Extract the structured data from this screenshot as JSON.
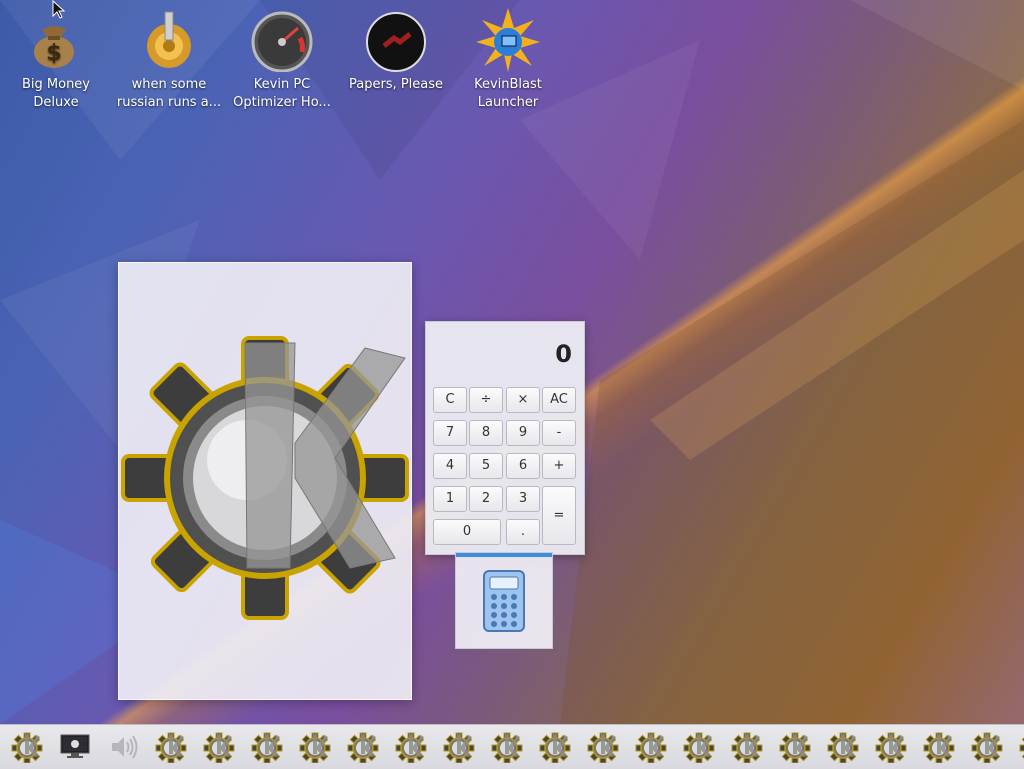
{
  "desktop": {
    "icons": [
      {
        "name": "money-bag-icon",
        "label": "Big Money Deluxe"
      },
      {
        "name": "gear-icon",
        "label": "when some russian runs a..."
      },
      {
        "name": "speedometer-icon",
        "label": "Kevin PC Optimizer Ho..."
      },
      {
        "name": "papers-please-icon",
        "label": "Papers, Please"
      },
      {
        "name": "kevinblast-icon",
        "label": "KevinBlast Launcher"
      }
    ]
  },
  "kde_window": {
    "icon": "kde-gear-logo-icon"
  },
  "calculator": {
    "display": "0",
    "buttons": [
      "C",
      "÷",
      "×",
      "AC",
      "7",
      "8",
      "9",
      "-",
      "4",
      "5",
      "6",
      "+",
      "1",
      "2",
      "3",
      "=",
      "0",
      "."
    ]
  },
  "calc_thumbnail": {
    "icon": "calculator-icon"
  },
  "taskbar": {
    "items": [
      "kde-gear-icon",
      "monitor-icon",
      "speaker-icon",
      "kde-gear-icon",
      "kde-gear-icon",
      "kde-gear-icon",
      "kde-gear-icon",
      "kde-gear-icon",
      "kde-gear-icon",
      "kde-gear-icon",
      "kde-gear-icon",
      "kde-gear-icon",
      "kde-gear-icon",
      "kde-gear-icon",
      "kde-gear-icon",
      "kde-gear-icon",
      "kde-gear-icon",
      "kde-gear-icon",
      "kde-gear-icon",
      "kde-gear-icon",
      "kde-gear-icon",
      "kde-gear-icon"
    ]
  },
  "colors": {
    "accent": "#3d8ee0",
    "panel": "#e3e2e8"
  }
}
